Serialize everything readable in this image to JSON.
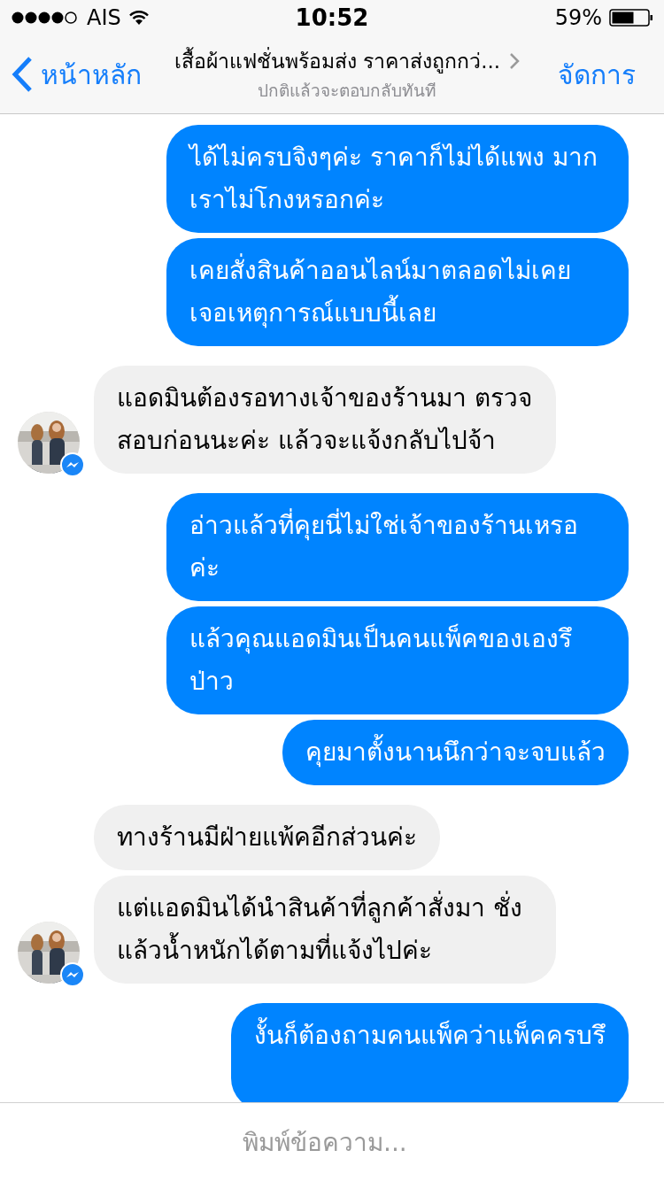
{
  "status_bar": {
    "carrier": "AIS",
    "time": "10:52",
    "battery": "59%"
  },
  "nav": {
    "back": "หน้าหลัก",
    "title": "เสื้อผ้าแฟชั่นพร้อมส่ง ราคาส่งถูกกว่...",
    "subtitle": "ปกติแล้วจะตอบกลับทันที",
    "action": "จัดการ"
  },
  "messages": [
    {
      "kind": "outgoing",
      "text": "ได้ไม่ครบจิงๆค่ะ ราคาก็ไม่ได้แพง มากเราไม่โกงหรอกค่ะ"
    },
    {
      "kind": "outgoing",
      "text": "เคยสั่งสินค้าออนไลน์มาตลอดไม่เคย เจอเหตุการณ์แบบนี้เลย"
    },
    {
      "kind": "incoming",
      "text": "แอดมินต้องรอทางเจ้าของร้านมา ตรวจสอบก่อนนะค่ะ แล้วจะแจ้งกลับไปจ้า",
      "avatar": true
    },
    {
      "kind": "outgoing",
      "text": "อ่าวแล้วที่คุยนี่ไม่ใช่เจ้าของร้านเหรอค่ะ"
    },
    {
      "kind": "outgoing",
      "text": "แล้วคุณแอดมินเป็นคนแพ็คของเองรึป่าว"
    },
    {
      "kind": "outgoing",
      "text": "คุยมาตั้งนานนึกว่าจะจบแล้ว"
    },
    {
      "kind": "incoming",
      "text": "ทางร้านมีฝ่ายแพ้คอีกส่วนค่ะ",
      "avatar": false
    },
    {
      "kind": "incoming",
      "text": "แต่แอดมินได้นำสินค้าที่ลูกค้าสั่งมา ชั่งแล้วน้ำหนักได้ตามที่แจ้งไปค่ะ",
      "avatar": true
    },
    {
      "kind": "outgoing",
      "text": "งั้นก็ต้องถามคนแพ็คว่าแพ็คครบรึ",
      "cut": true
    }
  ],
  "composer": {
    "placeholder": "พิมพ์ข้อความ..."
  }
}
